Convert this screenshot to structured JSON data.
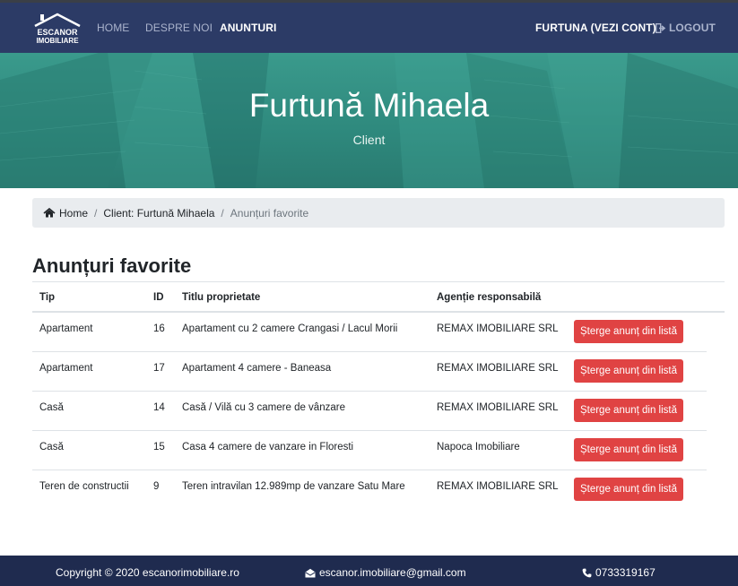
{
  "navbar": {
    "logo_text_line1": "ESCANOR",
    "logo_text_line2": "IMOBILIARE",
    "links": {
      "home": "HOME",
      "despre": "DESPRE NOI",
      "anunturi": "ANUNTURI"
    },
    "account": "FURTUNA (VEZI CONT)",
    "logout": "LOGOUT"
  },
  "hero": {
    "title": "Furtună Mihaela",
    "subtitle": "Client"
  },
  "breadcrumb": {
    "home": "Home",
    "client": "Client: Furtună Mihaela",
    "current": "Anunțuri favorite",
    "separator": "/"
  },
  "section_title": "Anunțuri favorite",
  "table": {
    "headers": {
      "tip": "Tip",
      "id": "ID",
      "titlu": "Titlu proprietate",
      "agentie": "Agenție responsabilă"
    },
    "delete_label": "Șterge anunț din listă",
    "rows": [
      {
        "tip": "Apartament",
        "id": "16",
        "titlu": "Apartament cu 2 camere Crangasi / Lacul Morii",
        "agentie": "REMAX IMOBILIARE SRL"
      },
      {
        "tip": "Apartament",
        "id": "17",
        "titlu": "Apartament 4 camere - Baneasa",
        "agentie": "REMAX IMOBILIARE SRL"
      },
      {
        "tip": "Casă",
        "id": "14",
        "titlu": "Casă / Vilă cu 3 camere de vânzare",
        "agentie": "REMAX IMOBILIARE SRL"
      },
      {
        "tip": "Casă",
        "id": "15",
        "titlu": "Casa 4 camere de vanzare in Floresti",
        "agentie": "Napoca Imobiliare"
      },
      {
        "tip": "Teren de constructii",
        "id": "9",
        "titlu": "Teren intravilan 12.989mp de vanzare Satu Mare",
        "agentie": "REMAX IMOBILIARE SRL"
      }
    ]
  },
  "footer": {
    "copyright": "Copyright © 2020 escanorimobiliare.ro",
    "email": "escanor.imobiliare@gmail.com",
    "phone": "0733319167"
  },
  "colors": {
    "navbar": "#2c3b66",
    "hero": "#2f8a7e",
    "delete_button": "#e04343",
    "footer": "#1f2b4f"
  }
}
